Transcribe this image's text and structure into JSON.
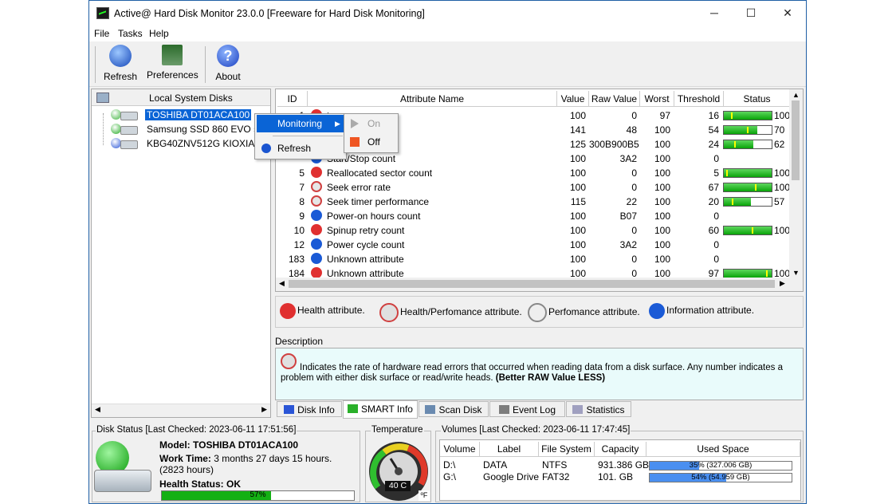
{
  "window": {
    "title": "Active@ Hard Disk Monitor 23.0.0 [Freeware for Hard Disk Monitoring]"
  },
  "window_controls": {
    "minimize": "─",
    "maximize": "☐",
    "close": "✕"
  },
  "menu": [
    "File",
    "Tasks",
    "Help"
  ],
  "toolbar": {
    "refresh": "Refresh",
    "preferences": "Preferences",
    "about": "About"
  },
  "left_panel": {
    "header": "Local System Disks",
    "disks": [
      {
        "name": "TOSHIBA DT01ACA100",
        "color": "#3fb43f"
      },
      {
        "name": "Samsung SSD 860 EVO 500",
        "color": "#22aa22"
      },
      {
        "name": "KBG40ZNV512G KIOXIA",
        "color": "#2a55d6"
      }
    ]
  },
  "context_menu": {
    "items": [
      {
        "label": "Monitoring",
        "icon": "arrow-icon"
      },
      {
        "label": "Refresh",
        "icon": "refresh-icon"
      }
    ],
    "submenu": [
      {
        "label": "On",
        "icon": "play-icon"
      },
      {
        "label": "Off",
        "icon": "stop-icon"
      }
    ]
  },
  "grid": {
    "columns": [
      "ID",
      "Attribute Name",
      "Value",
      "Raw Value",
      "Worst",
      "Threshold",
      "Status"
    ],
    "rows": [
      {
        "id": "1",
        "name": "te",
        "value": "100",
        "raw": "0",
        "worst": "97",
        "threshold": "16",
        "status_text": "100",
        "fill": 1.0,
        "mark": 0.16,
        "icon": "health"
      },
      {
        "id": "",
        "name": "rformance",
        "value": "141",
        "raw": "48",
        "worst": "100",
        "threshold": "54",
        "status_text": "70",
        "fill": 0.7,
        "mark": 0.5,
        "icon": "healthperf"
      },
      {
        "id": "",
        "name": "",
        "value": "125",
        "raw": "300B900B5",
        "worst": "100",
        "threshold": "24",
        "status_text": "62",
        "fill": 0.62,
        "mark": 0.22,
        "icon": "perf"
      },
      {
        "id": "",
        "name": "Start/Stop count",
        "value": "100",
        "raw": "3A2",
        "worst": "100",
        "threshold": "0",
        "status_text": "",
        "fill": null,
        "mark": null,
        "icon": "info"
      },
      {
        "id": "5",
        "name": "Reallocated sector count",
        "value": "100",
        "raw": "0",
        "worst": "100",
        "threshold": "5",
        "status_text": "100",
        "fill": 1.0,
        "mark": 0.05,
        "icon": "health"
      },
      {
        "id": "7",
        "name": "Seek error rate",
        "value": "100",
        "raw": "0",
        "worst": "100",
        "threshold": "67",
        "status_text": "100",
        "fill": 1.0,
        "mark": 0.67,
        "icon": "healthperf"
      },
      {
        "id": "8",
        "name": "Seek timer performance",
        "value": "115",
        "raw": "22",
        "worst": "100",
        "threshold": "20",
        "status_text": "57",
        "fill": 0.57,
        "mark": 0.18,
        "icon": "healthperf"
      },
      {
        "id": "9",
        "name": "Power-on hours count",
        "value": "100",
        "raw": "B07",
        "worst": "100",
        "threshold": "0",
        "status_text": "",
        "fill": null,
        "mark": null,
        "icon": "info"
      },
      {
        "id": "10",
        "name": "Spinup retry count",
        "value": "100",
        "raw": "0",
        "worst": "100",
        "threshold": "60",
        "status_text": "100",
        "fill": 1.0,
        "mark": 0.6,
        "icon": "health"
      },
      {
        "id": "12",
        "name": "Power cycle count",
        "value": "100",
        "raw": "3A2",
        "worst": "100",
        "threshold": "0",
        "status_text": "",
        "fill": null,
        "mark": null,
        "icon": "info"
      },
      {
        "id": "183",
        "name": "Unknown attribute",
        "value": "100",
        "raw": "0",
        "worst": "100",
        "threshold": "0",
        "status_text": "",
        "fill": null,
        "mark": null,
        "icon": "info"
      },
      {
        "id": "184",
        "name": "Unknown attribute",
        "value": "100",
        "raw": "0",
        "worst": "100",
        "threshold": "97",
        "status_text": "100",
        "fill": 1.0,
        "mark": 0.92,
        "icon": "health"
      }
    ]
  },
  "legend": {
    "health": "Health attribute.",
    "healthperf": "Health/Perfomance attribute.",
    "perf": "Perfomance attribute.",
    "info": "Information attribute."
  },
  "description": {
    "label": "Description",
    "text": "Indicates the rate of hardware read errors that occurred when reading data from a disk surface. Any number indicates a problem with either disk surface or read/write heads.",
    "bold": "(Better RAW Value LESS)"
  },
  "tabs": [
    "Disk Info",
    "SMART Info",
    "Scan Disk",
    "Event Log",
    "Statistics"
  ],
  "active_tab": "SMART Info",
  "disk_status": {
    "title": "Disk Status [Last Checked: 2023-06-11 17:51:56]",
    "model_label": "Model:",
    "model": "TOSHIBA DT01ACA100",
    "work_label": "Work Time:",
    "work_time": "3 months 27 days 15 hours. (2823 hours)",
    "health_label": "Health Status:",
    "health_status": "OK",
    "health_percent_text": "57%",
    "health_fraction": 0.57
  },
  "temperature": {
    "title": "Temperature",
    "value": "40 C",
    "unit": "ºF"
  },
  "volumes": {
    "title": "Volumes [Last Checked: 2023-06-11 17:47:45]",
    "columns": [
      "Volume",
      "Label",
      "File System",
      "Capacity",
      "Used Space"
    ],
    "rows": [
      {
        "volume": "D:\\",
        "label": "DATA",
        "fs": "NTFS",
        "capacity": "931.386 GB",
        "used": "35% (327.006 GB)",
        "fraction": 0.35
      },
      {
        "volume": "G:\\",
        "label": "Google Drive",
        "fs": "FAT32",
        "capacity": "101. GB",
        "used": "54% (54.959 GB)",
        "fraction": 0.54
      }
    ]
  },
  "colors": {
    "health": "#e03030",
    "perf": "#d06060",
    "info": "#1a5ad6",
    "selection": "#0a64d6",
    "bar": "#14b014"
  }
}
